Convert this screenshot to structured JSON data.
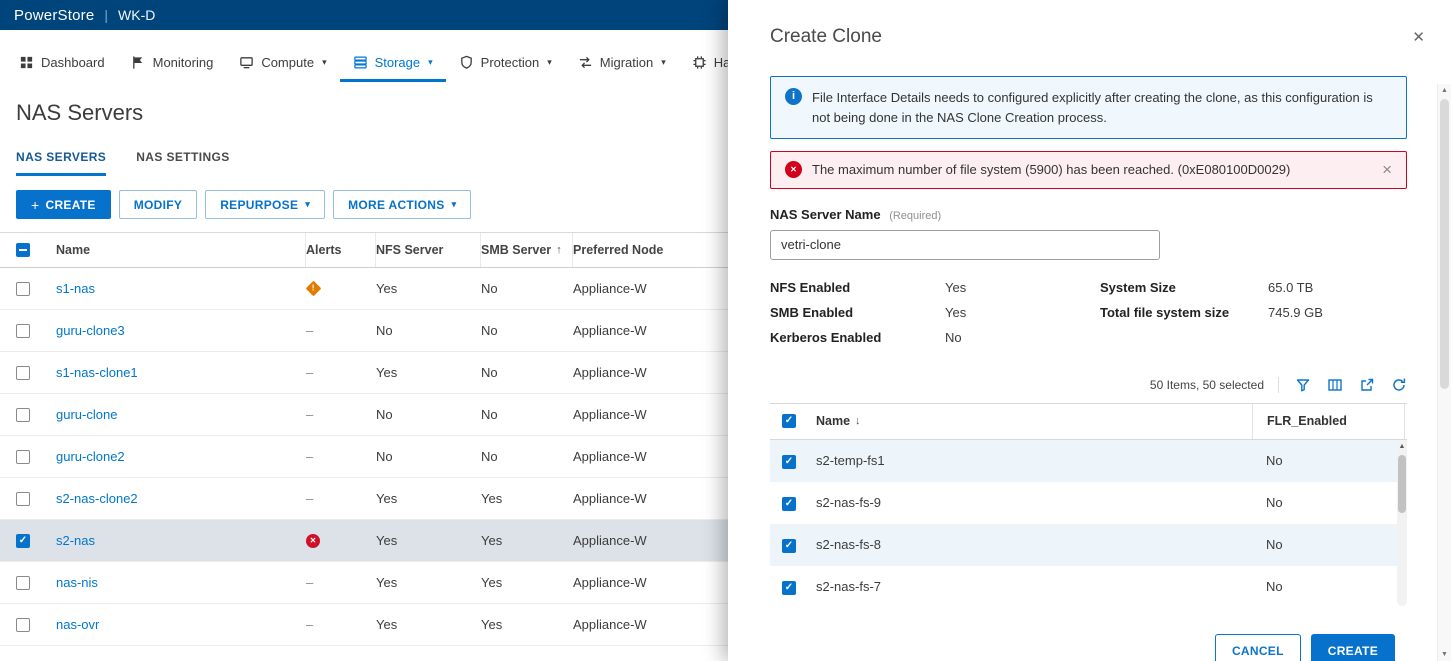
{
  "glyphs": {
    "separator": "|",
    "caret": "▾",
    "plus": "+",
    "sort_asc": "↑",
    "sort_desc": "↓",
    "dash": "–",
    "x": "✕",
    "close": "×",
    "info": "i",
    "exclamation": "!",
    "scroll_up": "▲",
    "scroll_down": "▼"
  },
  "colors": {
    "header_bar": "#00447c",
    "accent_blue": "#0672cb",
    "link_blue": "#0076ce",
    "error_red": "#ce1126",
    "warning_orange": "#e07c00",
    "info_banner_bg": "#f1f8fd",
    "error_banner_bg": "#fdeff1",
    "selected_row_bg": "#dce2e8"
  },
  "header": {
    "brand": "PowerStore",
    "system": "WK-D"
  },
  "nav": {
    "items": [
      {
        "label": "Dashboard"
      },
      {
        "label": "Monitoring"
      },
      {
        "label": "Compute"
      },
      {
        "label": "Storage"
      },
      {
        "label": "Protection"
      },
      {
        "label": "Migration"
      },
      {
        "label": "Har"
      }
    ]
  },
  "page": {
    "title": "NAS Servers"
  },
  "tabs": [
    {
      "label": "NAS SERVERS"
    },
    {
      "label": "NAS SETTINGS"
    }
  ],
  "toolbar": {
    "create": "CREATE",
    "modify": "MODIFY",
    "repurpose": "REPURPOSE",
    "more_actions": "MORE ACTIONS"
  },
  "table": {
    "columns": {
      "name": "Name",
      "alerts": "Alerts",
      "nfs": "NFS Server",
      "smb": "SMB Server",
      "node": "Preferred Node"
    },
    "rows": [
      {
        "name": "s1-nas",
        "alert": "warning",
        "nfs": "Yes",
        "smb": "No",
        "node": "Appliance-W"
      },
      {
        "name": "guru-clone3",
        "alert": "none",
        "nfs": "No",
        "smb": "No",
        "node": "Appliance-W"
      },
      {
        "name": "s1-nas-clone1",
        "alert": "none",
        "nfs": "Yes",
        "smb": "No",
        "node": "Appliance-W"
      },
      {
        "name": "guru-clone",
        "alert": "none",
        "nfs": "No",
        "smb": "No",
        "node": "Appliance-W"
      },
      {
        "name": "guru-clone2",
        "alert": "none",
        "nfs": "No",
        "smb": "No",
        "node": "Appliance-W"
      },
      {
        "name": "s2-nas-clone2",
        "alert": "none",
        "nfs": "Yes",
        "smb": "Yes",
        "node": "Appliance-W"
      },
      {
        "name": "s2-nas",
        "alert": "critical",
        "nfs": "Yes",
        "smb": "Yes",
        "node": "Appliance-W",
        "selected": true
      },
      {
        "name": "nas-nis",
        "alert": "none",
        "nfs": "Yes",
        "smb": "Yes",
        "node": "Appliance-W"
      },
      {
        "name": "nas-ovr",
        "alert": "none",
        "nfs": "Yes",
        "smb": "Yes",
        "node": "Appliance-W"
      }
    ]
  },
  "modal": {
    "title": "Create Clone",
    "info_banner": "File Interface Details needs to configured explicitly after creating the clone, as this configuration is not being done in the NAS Clone Creation process.",
    "error_banner": "The maximum number of file system (5900) has been reached. (0xE080100D0029)",
    "name_label": "NAS Server Name",
    "name_required": "(Required)",
    "name_value": "vetri-clone",
    "details": {
      "nfs_label": "NFS Enabled",
      "nfs_value": "Yes",
      "smb_label": "SMB Enabled",
      "smb_value": "Yes",
      "kerberos_label": "Kerberos Enabled",
      "kerberos_value": "No",
      "system_size_label": "System Size",
      "system_size_value": "65.0 TB",
      "total_fs_label": "Total file system size",
      "total_fs_value": "745.9 GB"
    },
    "items_summary": "50 Items, 50 selected",
    "fs_table": {
      "name_col": "Name",
      "flr_col": "FLR_Enabled",
      "rows": [
        {
          "name": "s2-temp-fs1",
          "flr": "No"
        },
        {
          "name": "s2-nas-fs-9",
          "flr": "No"
        },
        {
          "name": "s2-nas-fs-8",
          "flr": "No"
        },
        {
          "name": "s2-nas-fs-7",
          "flr": "No"
        }
      ]
    },
    "cancel_label": "CANCEL",
    "create_label": "CREATE"
  }
}
